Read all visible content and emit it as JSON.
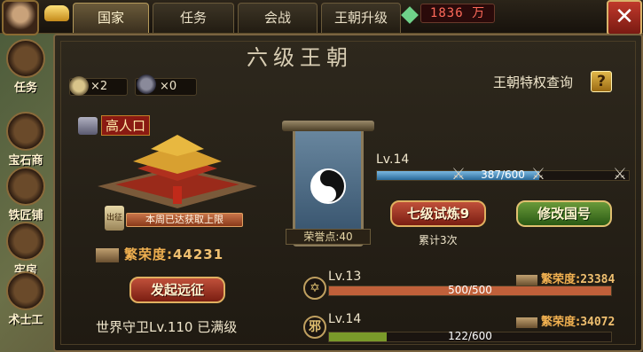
{
  "topbar": {
    "tabs": [
      "国家",
      "任务",
      "会战",
      "王朝升级"
    ],
    "active_tab": 0,
    "money": "1836 万"
  },
  "side_menu": [
    "任务",
    "宝石商",
    "铁匠铺",
    "牢房",
    "术士工"
  ],
  "resources": [
    {
      "count": "×2"
    },
    {
      "count": "×0"
    }
  ],
  "dynasty": {
    "title": "六级王朝",
    "privilege_link": "王朝特权查询",
    "help": "?",
    "population_label": "高人口",
    "weekly_limit": "本周已达获取上限",
    "chu_label": "出征",
    "prosperity_label": "繁荣度:",
    "prosperity_value": "44231",
    "expedition_button": "发起远征",
    "world_guard": "世界守卫Lv.110 已满级"
  },
  "banner": {
    "honor_points": "荣誉点:40"
  },
  "trial": {
    "level": "Lv.14",
    "progress_text": "387/600",
    "progress": 0.645,
    "trial_button": "七级试炼9",
    "rename_button": "修改国号",
    "cumulative": "累计3次"
  },
  "rows": [
    {
      "icon_glyph": "✡",
      "level": "Lv.13",
      "progress_text": "500/500",
      "progress": 1.0,
      "fill_color": "#c0603a",
      "prosperity_label": "繁荣度:",
      "prosperity_value": "23384"
    },
    {
      "icon_glyph": "邪",
      "level": "Lv.14",
      "progress_text": "122/600",
      "progress": 0.203,
      "fill_color": "#7a9a2a",
      "prosperity_label": "繁荣度:",
      "prosperity_value": "34072"
    }
  ]
}
